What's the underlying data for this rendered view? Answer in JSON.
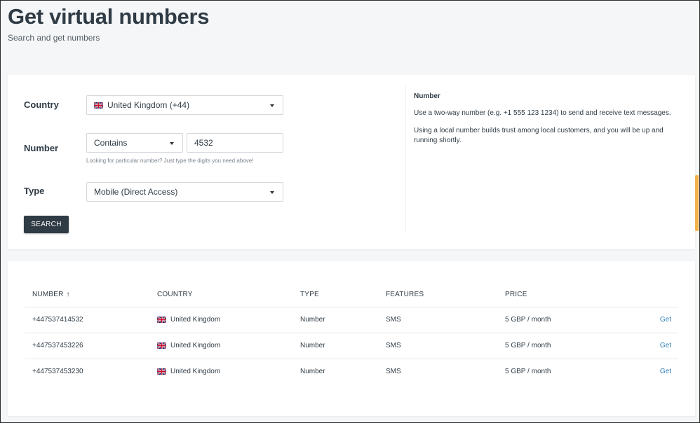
{
  "header": {
    "title": "Get virtual numbers",
    "subtitle": "Search and get numbers"
  },
  "search": {
    "country_label": "Country",
    "country_value": "United Kingdom (+44)",
    "number_label": "Number",
    "match_mode_value": "Contains",
    "number_value": "4532",
    "hint": "Looking for particular number? Just type the digits you need above!",
    "type_label": "Type",
    "type_value": "Mobile (Direct Access)",
    "button_label": "SEARCH"
  },
  "info": {
    "title": "Number",
    "paragraph1": "Use a two-way number (e.g. +1 555 123 1234) to send and receive text messages.",
    "paragraph2": "Using a local number builds trust among local customers, and you will be up and running shortly."
  },
  "table": {
    "headers": {
      "number": "NUMBER",
      "country": "COUNTRY",
      "type": "TYPE",
      "features": "FEATURES",
      "price": "PRICE"
    },
    "sort_icon": "arrow-up-icon",
    "rows": [
      {
        "number": "+447537414532",
        "country": "United Kingdom",
        "type": "Number",
        "features": "SMS",
        "price": "5 GBP / month",
        "action": "Get"
      },
      {
        "number": "+447537453226",
        "country": "United Kingdom",
        "type": "Number",
        "features": "SMS",
        "price": "5 GBP / month",
        "action": "Get"
      },
      {
        "number": "+447537453230",
        "country": "United Kingdom",
        "type": "Number",
        "features": "SMS",
        "price": "5 GBP / month",
        "action": "Get"
      }
    ]
  },
  "colors": {
    "primary_dark": "#2f3b45",
    "link": "#2a7ab0",
    "scroll_accent": "#f2b34a"
  }
}
